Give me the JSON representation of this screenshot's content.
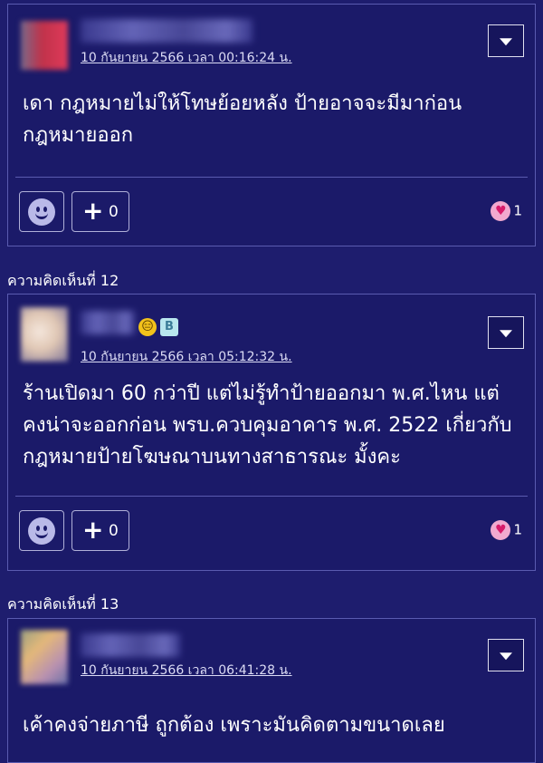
{
  "comments": [
    {
      "timestamp": "10 กันยายน 2566 เวลา 00:16:24 น.",
      "text": "เดา กฎหมายไม่ให้โทษย้อยหลัง ป้ายอาจจะมีมาก่อน กฎหมายออก",
      "plus_count": "0",
      "likes": "1"
    },
    {
      "label": "ความคิดเห็นที่ 12",
      "timestamp": "10 กันยายน 2566 เวลา 05:12:32 น.",
      "text": "ร้านเปิดมา 60 กว่าปี แต่ไม่รู้ทำป้ายออกมา พ.ศ.ไหน แต่คงน่าจะออกก่อน พรบ.ควบคุมอาคาร พ.ศ. 2522 เกี่ยวกับกฎหมายป้ายโฆษณาบนทางสาธารณะ มั้งคะ",
      "plus_count": "0",
      "likes": "1"
    },
    {
      "label": "ความคิดเห็นที่ 13",
      "timestamp": "10 กันยายน 2566 เวลา 06:41:28 น.",
      "text": "เค้าคงจ่ายภาษี ถูกต้อง เพราะมันคิดตามขนาดเลย"
    }
  ],
  "icons": {
    "badge_smile": "😑",
    "badge_box": "B",
    "plus": "+",
    "heart": "♥"
  },
  "colors": {
    "background": "#1e1d6e",
    "card": "#1b1a69",
    "border": "#5a5bb0",
    "heart_bg": "#f2a9cf"
  }
}
